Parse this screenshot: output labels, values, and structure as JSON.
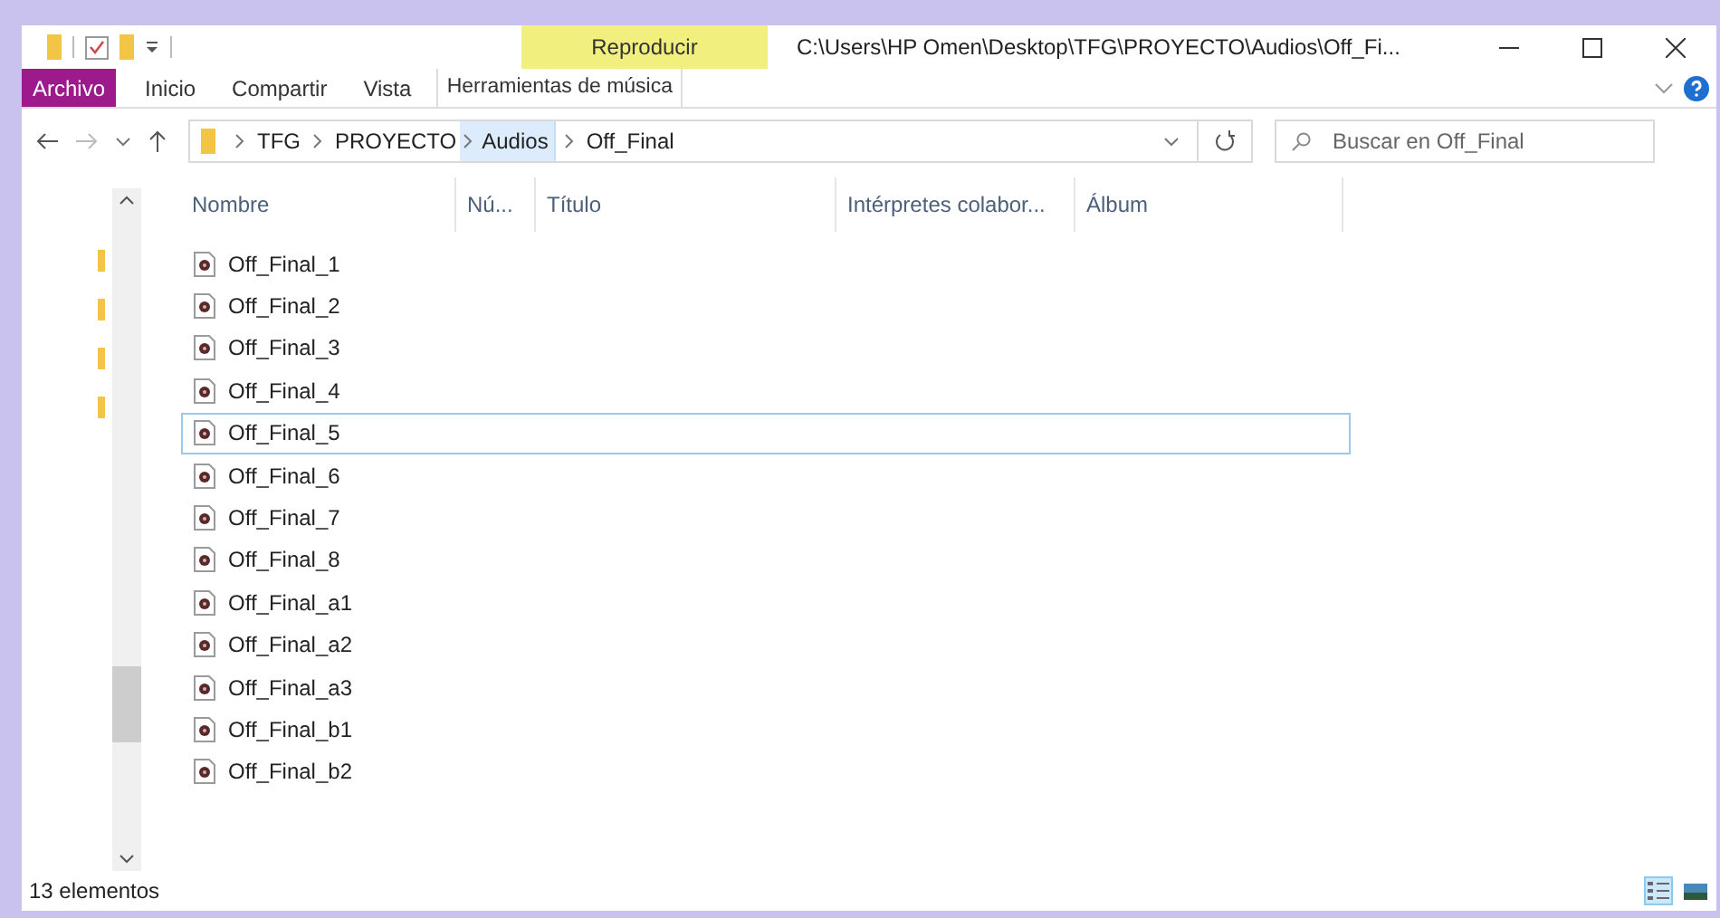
{
  "window": {
    "title": "C:\\Users\\HP Omen\\Desktop\\TFG\\PROYECTO\\Audios\\Off_Fi..."
  },
  "contextual_tab": {
    "label": "Reproducir",
    "group": "Herramientas de música"
  },
  "ribbon_tabs": [
    {
      "label": "Archivo",
      "selected": true
    },
    {
      "label": "Inicio",
      "selected": false
    },
    {
      "label": "Compartir",
      "selected": false
    },
    {
      "label": "Vista",
      "selected": false
    }
  ],
  "breadcrumb": [
    {
      "label": "TFG",
      "selected": false
    },
    {
      "label": "PROYECTO",
      "selected": false
    },
    {
      "label": "Audios",
      "selected": true
    },
    {
      "label": "Off_Final",
      "selected": false
    }
  ],
  "search": {
    "placeholder": "Buscar en Off_Final"
  },
  "columns": [
    "Nombre",
    "Nú...",
    "Título",
    "Intérpretes colabor...",
    "Álbum"
  ],
  "files": [
    {
      "name": "Off_Final_1",
      "selected": false
    },
    {
      "name": "Off_Final_2",
      "selected": false
    },
    {
      "name": "Off_Final_3",
      "selected": false
    },
    {
      "name": "Off_Final_4",
      "selected": false
    },
    {
      "name": "Off_Final_5",
      "selected": true
    },
    {
      "name": "Off_Final_6",
      "selected": false
    },
    {
      "name": "Off_Final_7",
      "selected": false
    },
    {
      "name": "Off_Final_8",
      "selected": false
    },
    {
      "name": "Off_Final_a1",
      "selected": false
    },
    {
      "name": "Off_Final_a2",
      "selected": false
    },
    {
      "name": "Off_Final_a3",
      "selected": false
    },
    {
      "name": "Off_Final_b1",
      "selected": false
    },
    {
      "name": "Off_Final_b2",
      "selected": false
    }
  ],
  "status_bar": {
    "count": "13 elementos"
  },
  "views": [
    {
      "kind": "details",
      "selected": true
    },
    {
      "kind": "tiles",
      "selected": false
    }
  ]
}
